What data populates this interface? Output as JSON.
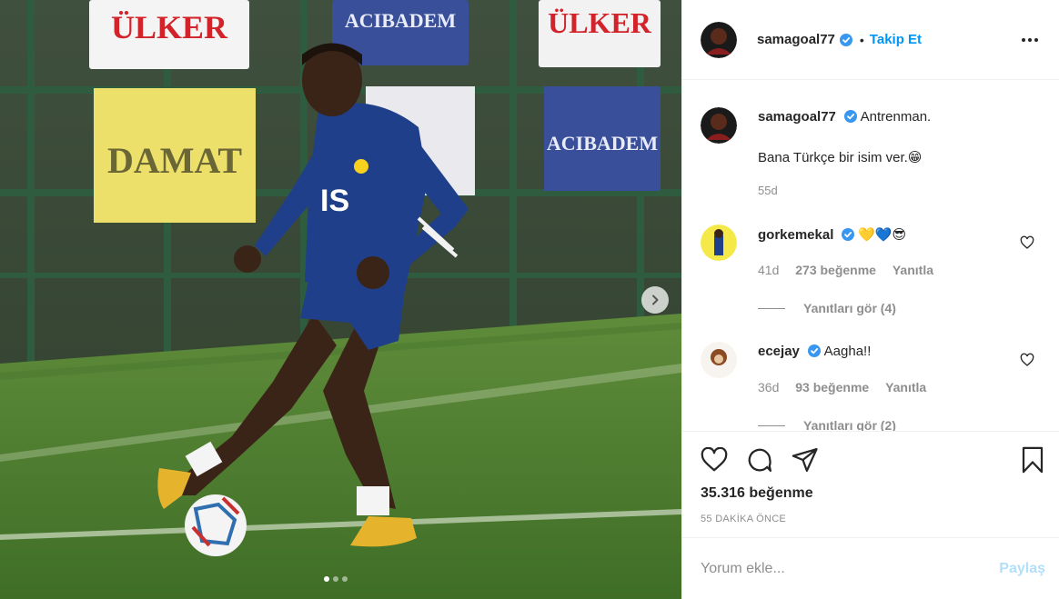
{
  "colors": {
    "accent": "#0095f6",
    "muted": "#8e8e8e",
    "verified": "#3897f0",
    "text": "#262626"
  },
  "media": {
    "banners": [
      "ÜLKER",
      "ACIBADEM",
      "ÜLKER",
      "DAMAT",
      "ACIBADEM"
    ],
    "carousel_total": 3,
    "carousel_active": 0,
    "next_icon": "chevron-right-icon"
  },
  "header": {
    "username": "samagoal77",
    "bullet": "•",
    "follow_label": "Takip Et",
    "more_icon": "more-horizontal-icon"
  },
  "caption": {
    "username": "samagoal77",
    "text_line1": "Antrenman.",
    "text_line2": "Bana Türkçe bir isim ver.",
    "emoji": "😁",
    "age": "55d"
  },
  "comments": [
    {
      "username": "gorkemekal",
      "text": "💛💙😎",
      "age": "41d",
      "likes": "273 beğenme",
      "reply_label": "Yanıtla",
      "view_replies": "Yanıtları gör (4)"
    },
    {
      "username": "ecejay",
      "text": "Aagha!!",
      "age": "36d",
      "likes": "93 beğenme",
      "reply_label": "Yanıtla",
      "view_replies": "Yanıtları gör (2)"
    }
  ],
  "actions": {
    "like_icon": "heart-icon",
    "comment_icon": "comment-icon",
    "share_icon": "paper-plane-icon",
    "save_icon": "bookmark-icon"
  },
  "stats": {
    "likes": "35.316 beğenme",
    "time": "55 DAKİKA ÖNCE"
  },
  "add_comment": {
    "placeholder": "Yorum ekle...",
    "post_label": "Paylaş"
  }
}
